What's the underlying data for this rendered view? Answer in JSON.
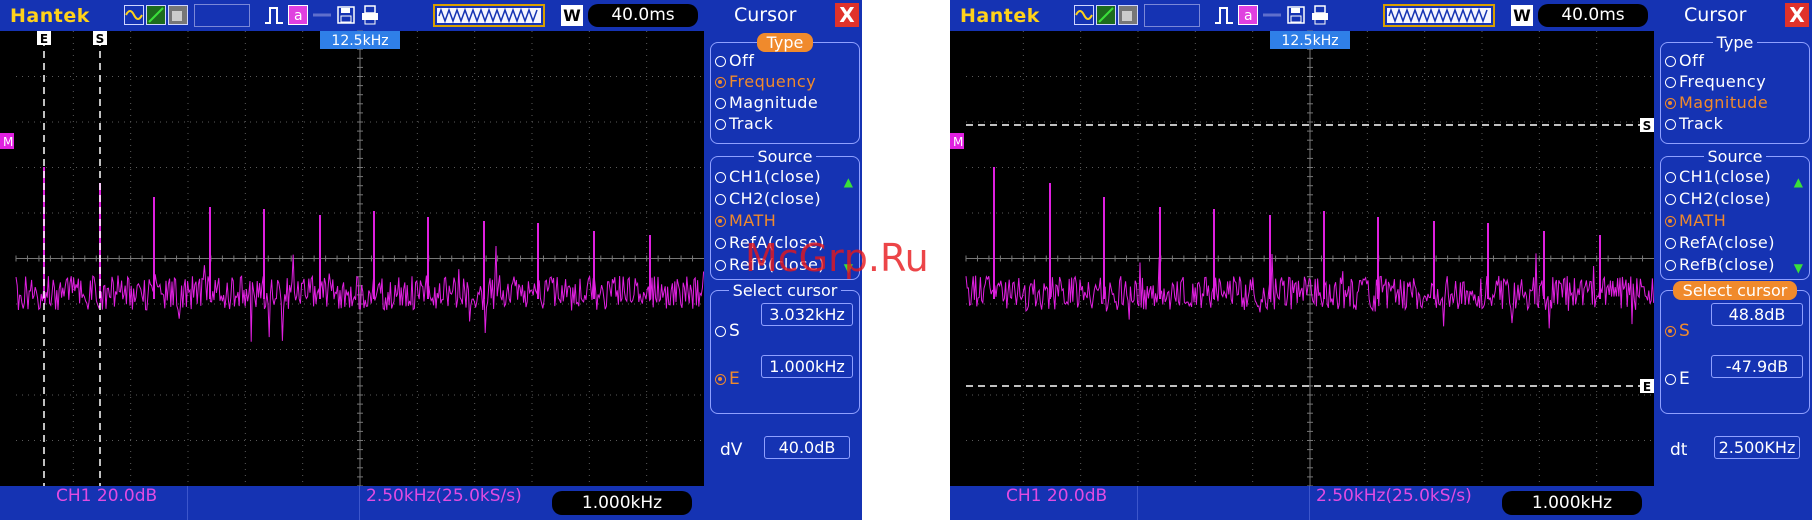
{
  "watermark": "McGrp.Ru",
  "panels": [
    {
      "brand": "Hantek",
      "w_button": "W",
      "timebase": "40.0ms",
      "center_marker": "12.5kHz",
      "math_marker": "M",
      "cursor_mode": "vertical",
      "cursor_e_label": "E",
      "cursor_s_label": "S",
      "status": {
        "channel": "CH1 20.0dB",
        "rate": "2.50kHz(25.0kS/s)",
        "readout": "1.000kHz"
      },
      "sidebar": {
        "title": "Cursor",
        "close": "X",
        "type_label": "Type",
        "type_highlight": true,
        "types": [
          {
            "label": "Off",
            "selected": false
          },
          {
            "label": "Frequency",
            "selected": true
          },
          {
            "label": "Magnitude",
            "selected": false
          },
          {
            "label": "Track",
            "selected": false
          }
        ],
        "source_label": "Source",
        "sources": [
          {
            "label": "CH1(close)",
            "selected": false
          },
          {
            "label": "CH2(close)",
            "selected": false
          },
          {
            "label": "MATH",
            "selected": true
          },
          {
            "label": "RefA(close)",
            "selected": false
          },
          {
            "label": "RefB(close)",
            "selected": false
          }
        ],
        "select_label": "Select cursor",
        "select_highlight": false,
        "s_label": "S",
        "s_value": "3.032kHz",
        "s_selected": false,
        "e_label": "E",
        "e_value": "1.000kHz",
        "e_selected": true,
        "delta_label": "dV",
        "delta_value": "40.0dB"
      }
    },
    {
      "brand": "Hantek",
      "w_button": "W",
      "timebase": "40.0ms",
      "center_marker": "12.5kHz",
      "math_marker": "M",
      "cursor_mode": "horizontal",
      "cursor_e_label": "E",
      "cursor_s_label": "S",
      "status": {
        "channel": "CH1 20.0dB",
        "rate": "2.50kHz(25.0kS/s)",
        "readout": "1.000kHz"
      },
      "sidebar": {
        "title": "Cursor",
        "close": "X",
        "type_label": "Type",
        "type_highlight": false,
        "types": [
          {
            "label": "Off",
            "selected": false
          },
          {
            "label": "Frequency",
            "selected": false
          },
          {
            "label": "Magnitude",
            "selected": true
          },
          {
            "label": "Track",
            "selected": false
          }
        ],
        "source_label": "Source",
        "sources": [
          {
            "label": "CH1(close)",
            "selected": false
          },
          {
            "label": "CH2(close)",
            "selected": false
          },
          {
            "label": "MATH",
            "selected": true
          },
          {
            "label": "RefA(close)",
            "selected": false
          },
          {
            "label": "RefB(close)",
            "selected": false
          }
        ],
        "select_label": "Select cursor",
        "select_highlight": true,
        "s_label": "S",
        "s_value": "48.8dB",
        "s_selected": true,
        "e_label": "E",
        "e_value": "-47.9dB",
        "e_selected": false,
        "delta_label": "dt",
        "delta_value": "2.500KHz"
      }
    }
  ],
  "colors": {
    "trace": "#e020e0",
    "panel_blue": "#1533b3",
    "accent_orange": "#f08a2c",
    "brand_yellow": "#ffd21a",
    "grid": "#5a5a5a"
  }
}
